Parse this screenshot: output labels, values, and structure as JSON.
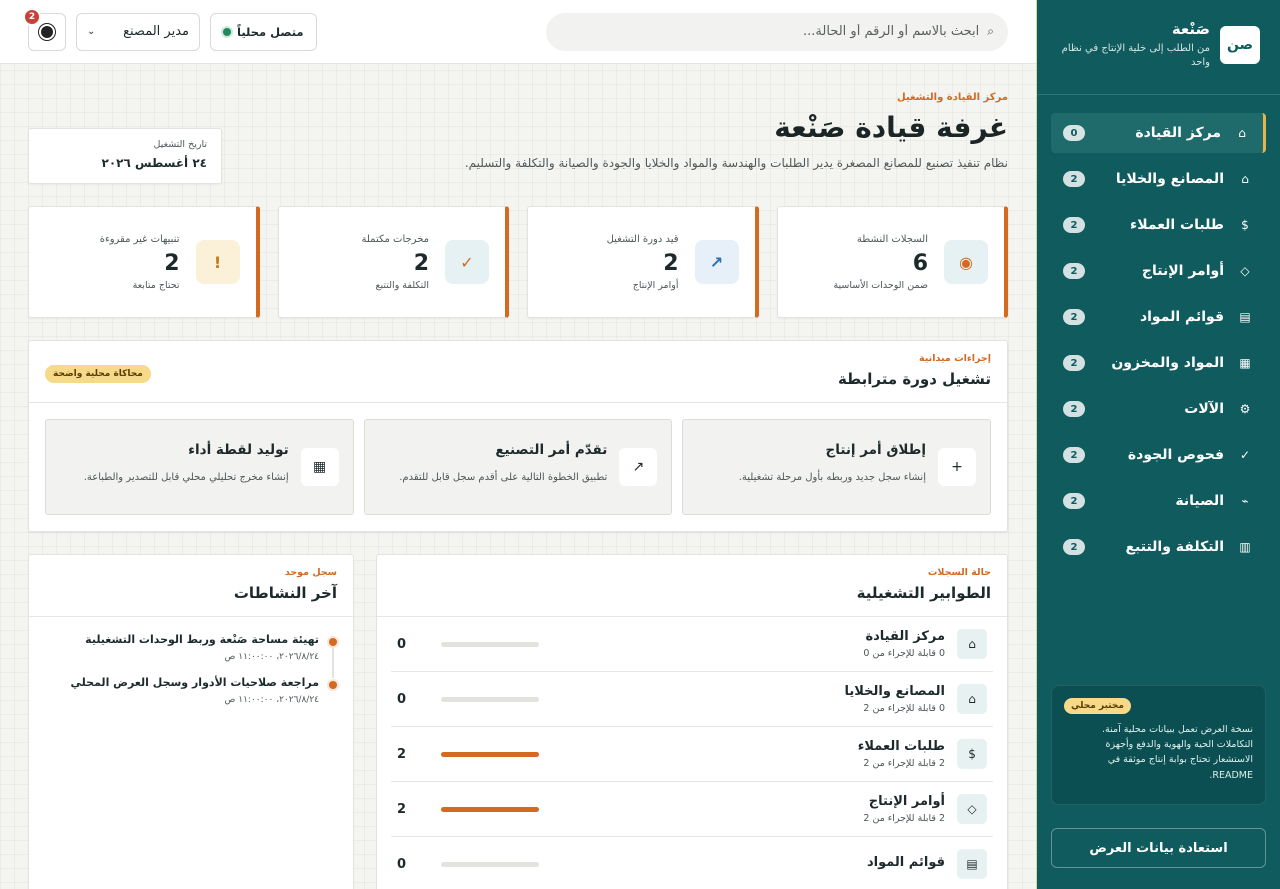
{
  "brand": {
    "logo": "صن",
    "name": "صَنْعة",
    "tagline": "من الطلب إلى خلية الإنتاج في نظام واحد"
  },
  "nav": [
    {
      "label": "مركز القيادة",
      "icon": "⌂",
      "badge": "0",
      "active": true
    },
    {
      "label": "المصانع والخلايا",
      "icon": "⌂",
      "badge": "2"
    },
    {
      "label": "طلبات العملاء",
      "icon": "$",
      "badge": "2"
    },
    {
      "label": "أوامر الإنتاج",
      "icon": "◇",
      "badge": "2"
    },
    {
      "label": "قوائم المواد",
      "icon": "▤",
      "badge": "2"
    },
    {
      "label": "المواد والمخزون",
      "icon": "▦",
      "badge": "2"
    },
    {
      "label": "الآلات",
      "icon": "⚙",
      "badge": "2"
    },
    {
      "label": "فحوص الجودة",
      "icon": "✓",
      "badge": "2"
    },
    {
      "label": "الصيانة",
      "icon": "⌁",
      "badge": "2"
    },
    {
      "label": "التكلفة والتتبع",
      "icon": "▥",
      "badge": "2"
    }
  ],
  "lab": {
    "badge": "مختبر محلي",
    "text": "نسخة العرض تعمل ببيانات محلية آمنة. التكاملات الحية والهوية والدفع وأجهزة الاستشعار تحتاج بوابة إنتاج موثقة في README."
  },
  "restore_label": "استعادة بيانات العرض",
  "topbar": {
    "search_placeholder": "ابحث بالاسم أو الرقم أو الحالة...",
    "status": "متصل محلياً",
    "role": "مدير المصنع",
    "notif_count": "2"
  },
  "header": {
    "eyebrow": "مركز القيادة والتشغيل",
    "title": "غرفة قيادة صَنْعة",
    "desc": "نظام تنفيذ تصنيع للمصانع المصغرة يدير الطلبات والهندسة والمواد والخلايا والجودة والصيانة والتكلفة والتسليم.",
    "date_label": "تاريخ التشغيل",
    "date_value": "٢٤ أغسطس ٢٠٢٦"
  },
  "stats": [
    {
      "label": "السجلات النشطة",
      "value": "6",
      "sub": "ضمن الوحدات الأساسية",
      "icon": "◉",
      "icon_color": "#d36a22",
      "icon_bg": "#e5f1f2"
    },
    {
      "label": "قيد دورة التشغيل",
      "value": "2",
      "sub": "أوامر الإنتاج",
      "icon": "↗",
      "icon_color": "#2a6fb0",
      "icon_bg": "#e7f0f8"
    },
    {
      "label": "مخرجات مكتملة",
      "value": "2",
      "sub": "التكلفة والتتبع",
      "icon": "✓",
      "icon_color": "#d36a22",
      "icon_bg": "#e5f1f2"
    },
    {
      "label": "تنبيهات غير مقروءة",
      "value": "2",
      "sub": "تحتاج متابعة",
      "icon": "!",
      "icon_color": "#c9781a",
      "icon_bg": "#fbf0d8"
    }
  ],
  "cycle": {
    "eyebrow": "إجراءات ميدانية",
    "title": "تشغيل دورة مترابطة",
    "badge": "محاكاة محلية واضحة",
    "actions": [
      {
        "title": "إطلاق أمر إنتاج",
        "desc": "إنشاء سجل جديد وربطه بأول مرحلة تشغيلية.",
        "icon": "+"
      },
      {
        "title": "تقدّم أمر التصنيع",
        "desc": "تطبيق الخطوة التالية على أقدم سجل قابل للتقدم.",
        "icon": "↗"
      },
      {
        "title": "توليد لقطة أداء",
        "desc": "إنشاء مخرج تحليلي محلي قابل للتصدير والطباعة.",
        "icon": "▦"
      }
    ]
  },
  "queues": {
    "eyebrow": "حالة السجلات",
    "title": "الطوابير التشغيلية",
    "rows": [
      {
        "name": "مركز القيادة",
        "sub": "0 قابلة للإجراء من 0",
        "value": "0",
        "fill": 0,
        "icon": "⌂"
      },
      {
        "name": "المصانع والخلايا",
        "sub": "0 قابلة للإجراء من 2",
        "value": "0",
        "fill": 0,
        "icon": "⌂"
      },
      {
        "name": "طلبات العملاء",
        "sub": "2 قابلة للإجراء من 2",
        "value": "2",
        "fill": 1,
        "icon": "$"
      },
      {
        "name": "أوامر الإنتاج",
        "sub": "2 قابلة للإجراء من 2",
        "value": "2",
        "fill": 1,
        "icon": "◇"
      },
      {
        "name": "قوائم المواد",
        "sub": "",
        "value": "0",
        "fill": 0,
        "icon": "▤"
      }
    ]
  },
  "activity": {
    "eyebrow": "سجل موحد",
    "title": "آخر النشاطات",
    "items": [
      {
        "title": "تهيئة مساحة صَنْعة وربط الوحدات التشغيلية",
        "time": "٢٠٢٦/٨/٢٤، ١١:٠٠:٠٠ ص"
      },
      {
        "title": "مراجعة صلاحيات الأدوار وسجل العرض المحلي",
        "time": "٢٠٢٦/٨/٢٤، ١١:٠٠:٠٠ ص"
      }
    ]
  }
}
